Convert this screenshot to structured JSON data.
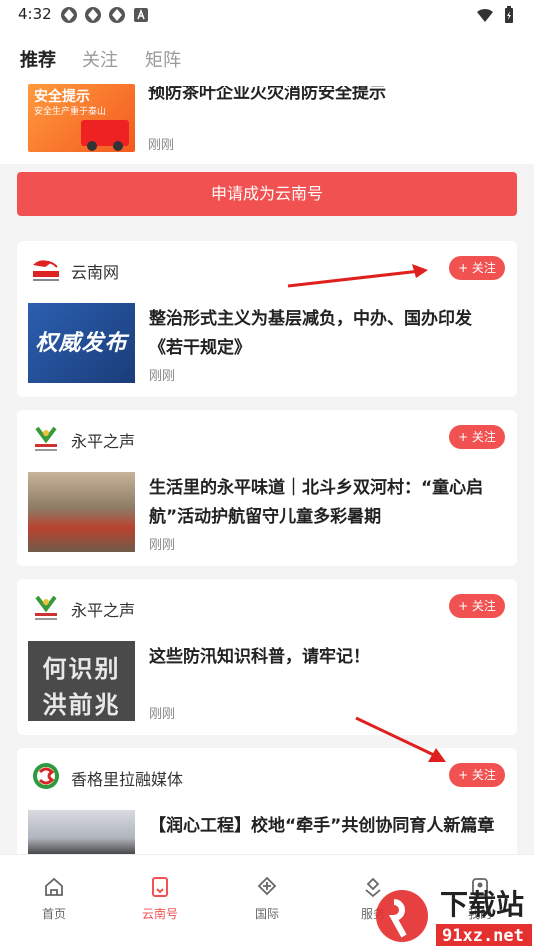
{
  "status": {
    "time": "4:32"
  },
  "tabs": [
    {
      "label": "推荐"
    },
    {
      "label": "关注"
    },
    {
      "label": "矩阵"
    }
  ],
  "top_item": {
    "title": "预防茶叶企业火灾消防安全提示",
    "time": "刚刚",
    "thumb_text": "安全提示",
    "thumb_sub": "安全生产重于泰山"
  },
  "apply_button": {
    "label": "申请成为云南号"
  },
  "cards": [
    {
      "source": "云南网",
      "follow": "+ 关注",
      "title": "整治形式主义为基层减负，中办、国办印发《若干规定》",
      "time": "刚刚",
      "thumb_text": "权威发布"
    },
    {
      "source": "永平之声",
      "follow": "+ 关注",
      "title": "生活里的永平味道｜北斗乡双河村：“童心启航”活动护航留守儿童多彩暑期",
      "time": "刚刚"
    },
    {
      "source": "永平之声",
      "follow": "+ 关注",
      "title": "这些防汛知识科普，请牢记！",
      "time": "刚刚",
      "thumb_text_1": "何识别",
      "thumb_text_2": "洪前兆"
    },
    {
      "source": "香格里拉融媒体",
      "follow": "+ 关注",
      "title": "【润心工程】校地“牵手”共创协同育人新篇章"
    }
  ],
  "bottom_nav": [
    {
      "label": "首页",
      "icon": "home-icon"
    },
    {
      "label": "云南号",
      "icon": "yunnan-hao-icon"
    },
    {
      "label": "国际",
      "icon": "globe-icon"
    },
    {
      "label": "服务",
      "icon": "service-icon"
    },
    {
      "label": "我的",
      "icon": "user-icon"
    }
  ],
  "watermark": {
    "text": "下载站",
    "url": "91xz.net"
  },
  "colors": {
    "accent": "#f15151",
    "annotation_arrow": "#e0201e"
  }
}
